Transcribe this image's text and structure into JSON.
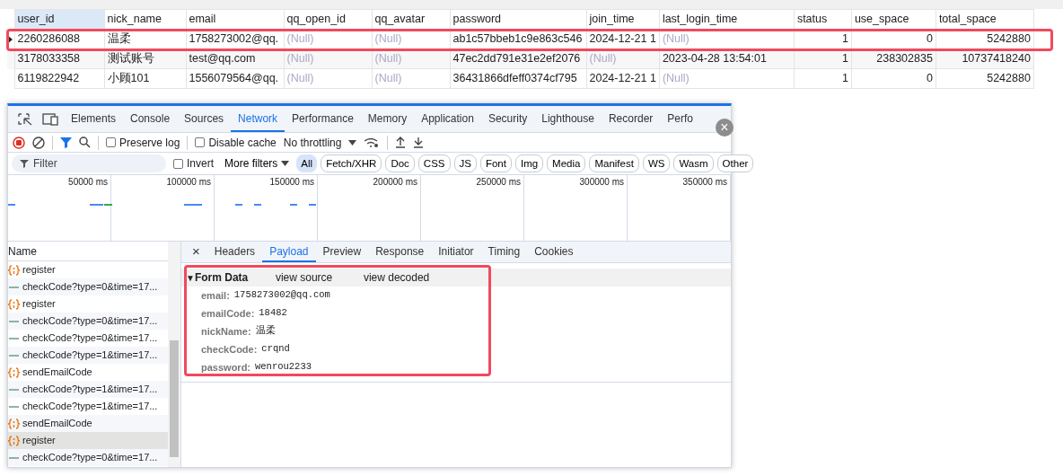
{
  "table": {
    "columns": [
      "user_id",
      "nick_name",
      "email",
      "qq_open_id",
      "qq_avatar",
      "password",
      "join_time",
      "last_login_time",
      "status",
      "use_space",
      "total_space"
    ],
    "rows": [
      {
        "current": true,
        "highlighted": true,
        "cells": [
          {
            "text": "2260286088"
          },
          {
            "text": "温柔"
          },
          {
            "text": "1758273002@qq."
          },
          {
            "text": "(Null)",
            "null": true
          },
          {
            "text": "(Null)",
            "null": true
          },
          {
            "text": "ab1c57bbeb1c9e863c546"
          },
          {
            "text": "2024-12-21 1"
          },
          {
            "text": "(Null)",
            "null": true
          },
          {
            "text": "1",
            "num": true
          },
          {
            "text": "0",
            "num": true
          },
          {
            "text": "5242880",
            "num": true
          }
        ]
      },
      {
        "current": false,
        "highlighted": false,
        "cells": [
          {
            "text": "3178033358"
          },
          {
            "text": "测试账号"
          },
          {
            "text": "test@qq.com"
          },
          {
            "text": "(Null)",
            "null": true
          },
          {
            "text": "(Null)",
            "null": true
          },
          {
            "text": "47ec2dd791e31e2ef2076"
          },
          {
            "text": "(Null)",
            "null": true
          },
          {
            "text": "2023-04-28 13:54:01"
          },
          {
            "text": "1",
            "num": true
          },
          {
            "text": "238302835",
            "num": true
          },
          {
            "text": "10737418240",
            "num": true
          }
        ]
      },
      {
        "current": false,
        "highlighted": false,
        "cells": [
          {
            "text": "6119822942"
          },
          {
            "text": "小顾101"
          },
          {
            "text": "1556079564@qq."
          },
          {
            "text": "(Null)",
            "null": true
          },
          {
            "text": "(Null)",
            "null": true
          },
          {
            "text": "36431866dfeff0374cf795"
          },
          {
            "text": "2024-12-21 1"
          },
          {
            "text": "(Null)",
            "null": true
          },
          {
            "text": "1",
            "num": true
          },
          {
            "text": "0",
            "num": true
          },
          {
            "text": "5242880",
            "num": true
          }
        ]
      }
    ]
  },
  "devtools": {
    "close": "×",
    "tabs": [
      {
        "label": "Elements",
        "selected": false
      },
      {
        "label": "Console",
        "selected": false
      },
      {
        "label": "Sources",
        "selected": false
      },
      {
        "label": "Network",
        "selected": true
      },
      {
        "label": "Performance",
        "selected": false
      },
      {
        "label": "Memory",
        "selected": false
      },
      {
        "label": "Application",
        "selected": false
      },
      {
        "label": "Security",
        "selected": false
      },
      {
        "label": "Lighthouse",
        "selected": false
      },
      {
        "label": "Recorder",
        "selected": false
      },
      {
        "label": "Perfo",
        "selected": false
      }
    ],
    "toolbar": {
      "preserve_log": {
        "label": "Preserve log",
        "checked": false
      },
      "disable_cache": {
        "label": "Disable cache",
        "checked": false
      },
      "throttling": "No throttling"
    },
    "filter": {
      "placeholder": "Filter",
      "invert": {
        "label": "Invert",
        "checked": false
      },
      "more_filters": "More filters",
      "types": [
        {
          "label": "All",
          "selected": true
        },
        {
          "label": "Fetch/XHR",
          "selected": false
        },
        {
          "label": "Doc",
          "selected": false
        },
        {
          "label": "CSS",
          "selected": false
        },
        {
          "label": "JS",
          "selected": false
        },
        {
          "label": "Font",
          "selected": false
        },
        {
          "label": "Img",
          "selected": false
        },
        {
          "label": "Media",
          "selected": false
        },
        {
          "label": "Manifest",
          "selected": false
        },
        {
          "label": "WS",
          "selected": false
        },
        {
          "label": "Wasm",
          "selected": false
        },
        {
          "label": "Other",
          "selected": false
        }
      ]
    },
    "timeline": {
      "ticks": [
        "50000 ms",
        "100000 ms",
        "150000 ms",
        "200000 ms",
        "250000 ms",
        "300000 ms",
        "350000 ms"
      ]
    },
    "requests": {
      "header": "Name",
      "items": [
        {
          "name": "register",
          "kind": "fetch",
          "selected": false
        },
        {
          "name": "checkCode?type=0&time=17...",
          "kind": "image",
          "selected": false
        },
        {
          "name": "register",
          "kind": "fetch",
          "selected": false
        },
        {
          "name": "checkCode?type=0&time=17...",
          "kind": "image",
          "selected": false
        },
        {
          "name": "checkCode?type=0&time=17...",
          "kind": "image",
          "selected": false
        },
        {
          "name": "checkCode?type=1&time=17...",
          "kind": "image",
          "selected": false
        },
        {
          "name": "sendEmailCode",
          "kind": "fetch",
          "selected": false
        },
        {
          "name": "checkCode?type=1&time=17...",
          "kind": "image",
          "selected": false
        },
        {
          "name": "checkCode?type=1&time=17...",
          "kind": "image",
          "selected": false
        },
        {
          "name": "sendEmailCode",
          "kind": "fetch",
          "selected": false
        },
        {
          "name": "register",
          "kind": "fetch",
          "selected": true
        },
        {
          "name": "checkCode?type=0&time=17...",
          "kind": "image",
          "selected": false
        }
      ]
    },
    "detail": {
      "close": "×",
      "tabs": [
        {
          "label": "Headers",
          "selected": false
        },
        {
          "label": "Payload",
          "selected": true
        },
        {
          "label": "Preview",
          "selected": false
        },
        {
          "label": "Response",
          "selected": false
        },
        {
          "label": "Initiator",
          "selected": false
        },
        {
          "label": "Timing",
          "selected": false
        },
        {
          "label": "Cookies",
          "selected": false
        }
      ],
      "form_data": {
        "toggle": "▼",
        "title": "Form Data",
        "expanded": true,
        "highlighted": true,
        "links": [
          "view source",
          "view decoded"
        ],
        "fields": [
          {
            "key": "email:",
            "value": "1758273002@qq.com"
          },
          {
            "key": "emailCode:",
            "value": "18482"
          },
          {
            "key": "nickName:",
            "value": "温柔"
          },
          {
            "key": "checkCode:",
            "value": "crqnd"
          },
          {
            "key": "password:",
            "value": "wenrou2233"
          }
        ]
      }
    }
  }
}
